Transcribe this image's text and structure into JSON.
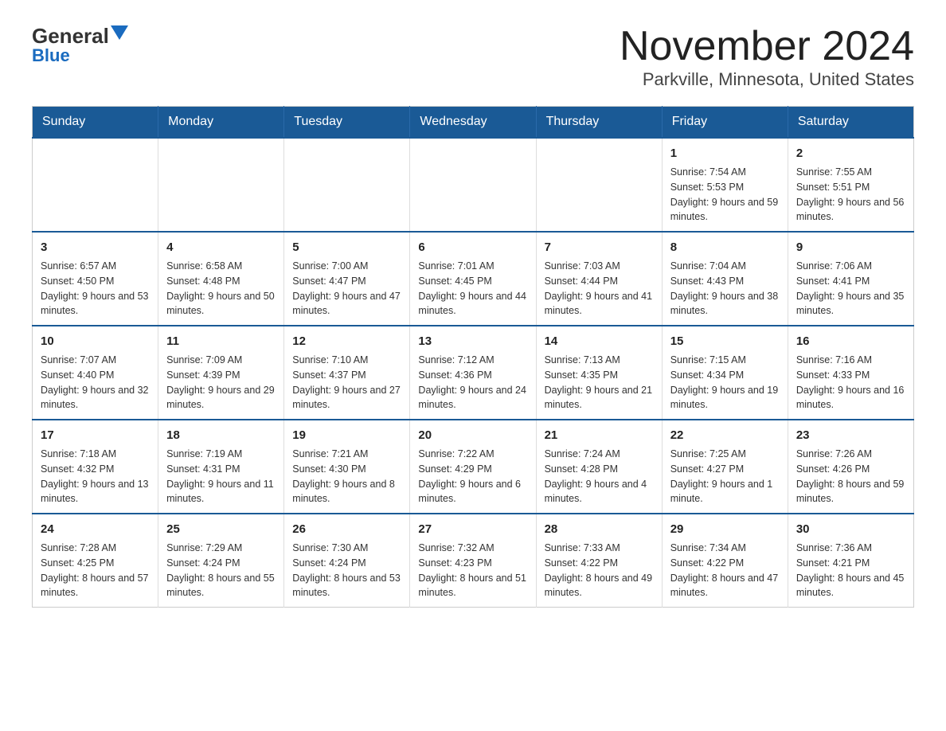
{
  "logo": {
    "general": "General",
    "blue": "Blue"
  },
  "title": "November 2024",
  "subtitle": "Parkville, Minnesota, United States",
  "days": [
    "Sunday",
    "Monday",
    "Tuesday",
    "Wednesday",
    "Thursday",
    "Friday",
    "Saturday"
  ],
  "weeks": [
    [
      {
        "day": "",
        "info": ""
      },
      {
        "day": "",
        "info": ""
      },
      {
        "day": "",
        "info": ""
      },
      {
        "day": "",
        "info": ""
      },
      {
        "day": "",
        "info": ""
      },
      {
        "day": "1",
        "info": "Sunrise: 7:54 AM\nSunset: 5:53 PM\nDaylight: 9 hours and 59 minutes."
      },
      {
        "day": "2",
        "info": "Sunrise: 7:55 AM\nSunset: 5:51 PM\nDaylight: 9 hours and 56 minutes."
      }
    ],
    [
      {
        "day": "3",
        "info": "Sunrise: 6:57 AM\nSunset: 4:50 PM\nDaylight: 9 hours and 53 minutes."
      },
      {
        "day": "4",
        "info": "Sunrise: 6:58 AM\nSunset: 4:48 PM\nDaylight: 9 hours and 50 minutes."
      },
      {
        "day": "5",
        "info": "Sunrise: 7:00 AM\nSunset: 4:47 PM\nDaylight: 9 hours and 47 minutes."
      },
      {
        "day": "6",
        "info": "Sunrise: 7:01 AM\nSunset: 4:45 PM\nDaylight: 9 hours and 44 minutes."
      },
      {
        "day": "7",
        "info": "Sunrise: 7:03 AM\nSunset: 4:44 PM\nDaylight: 9 hours and 41 minutes."
      },
      {
        "day": "8",
        "info": "Sunrise: 7:04 AM\nSunset: 4:43 PM\nDaylight: 9 hours and 38 minutes."
      },
      {
        "day": "9",
        "info": "Sunrise: 7:06 AM\nSunset: 4:41 PM\nDaylight: 9 hours and 35 minutes."
      }
    ],
    [
      {
        "day": "10",
        "info": "Sunrise: 7:07 AM\nSunset: 4:40 PM\nDaylight: 9 hours and 32 minutes."
      },
      {
        "day": "11",
        "info": "Sunrise: 7:09 AM\nSunset: 4:39 PM\nDaylight: 9 hours and 29 minutes."
      },
      {
        "day": "12",
        "info": "Sunrise: 7:10 AM\nSunset: 4:37 PM\nDaylight: 9 hours and 27 minutes."
      },
      {
        "day": "13",
        "info": "Sunrise: 7:12 AM\nSunset: 4:36 PM\nDaylight: 9 hours and 24 minutes."
      },
      {
        "day": "14",
        "info": "Sunrise: 7:13 AM\nSunset: 4:35 PM\nDaylight: 9 hours and 21 minutes."
      },
      {
        "day": "15",
        "info": "Sunrise: 7:15 AM\nSunset: 4:34 PM\nDaylight: 9 hours and 19 minutes."
      },
      {
        "day": "16",
        "info": "Sunrise: 7:16 AM\nSunset: 4:33 PM\nDaylight: 9 hours and 16 minutes."
      }
    ],
    [
      {
        "day": "17",
        "info": "Sunrise: 7:18 AM\nSunset: 4:32 PM\nDaylight: 9 hours and 13 minutes."
      },
      {
        "day": "18",
        "info": "Sunrise: 7:19 AM\nSunset: 4:31 PM\nDaylight: 9 hours and 11 minutes."
      },
      {
        "day": "19",
        "info": "Sunrise: 7:21 AM\nSunset: 4:30 PM\nDaylight: 9 hours and 8 minutes."
      },
      {
        "day": "20",
        "info": "Sunrise: 7:22 AM\nSunset: 4:29 PM\nDaylight: 9 hours and 6 minutes."
      },
      {
        "day": "21",
        "info": "Sunrise: 7:24 AM\nSunset: 4:28 PM\nDaylight: 9 hours and 4 minutes."
      },
      {
        "day": "22",
        "info": "Sunrise: 7:25 AM\nSunset: 4:27 PM\nDaylight: 9 hours and 1 minute."
      },
      {
        "day": "23",
        "info": "Sunrise: 7:26 AM\nSunset: 4:26 PM\nDaylight: 8 hours and 59 minutes."
      }
    ],
    [
      {
        "day": "24",
        "info": "Sunrise: 7:28 AM\nSunset: 4:25 PM\nDaylight: 8 hours and 57 minutes."
      },
      {
        "day": "25",
        "info": "Sunrise: 7:29 AM\nSunset: 4:24 PM\nDaylight: 8 hours and 55 minutes."
      },
      {
        "day": "26",
        "info": "Sunrise: 7:30 AM\nSunset: 4:24 PM\nDaylight: 8 hours and 53 minutes."
      },
      {
        "day": "27",
        "info": "Sunrise: 7:32 AM\nSunset: 4:23 PM\nDaylight: 8 hours and 51 minutes."
      },
      {
        "day": "28",
        "info": "Sunrise: 7:33 AM\nSunset: 4:22 PM\nDaylight: 8 hours and 49 minutes."
      },
      {
        "day": "29",
        "info": "Sunrise: 7:34 AM\nSunset: 4:22 PM\nDaylight: 8 hours and 47 minutes."
      },
      {
        "day": "30",
        "info": "Sunrise: 7:36 AM\nSunset: 4:21 PM\nDaylight: 8 hours and 45 minutes."
      }
    ]
  ]
}
